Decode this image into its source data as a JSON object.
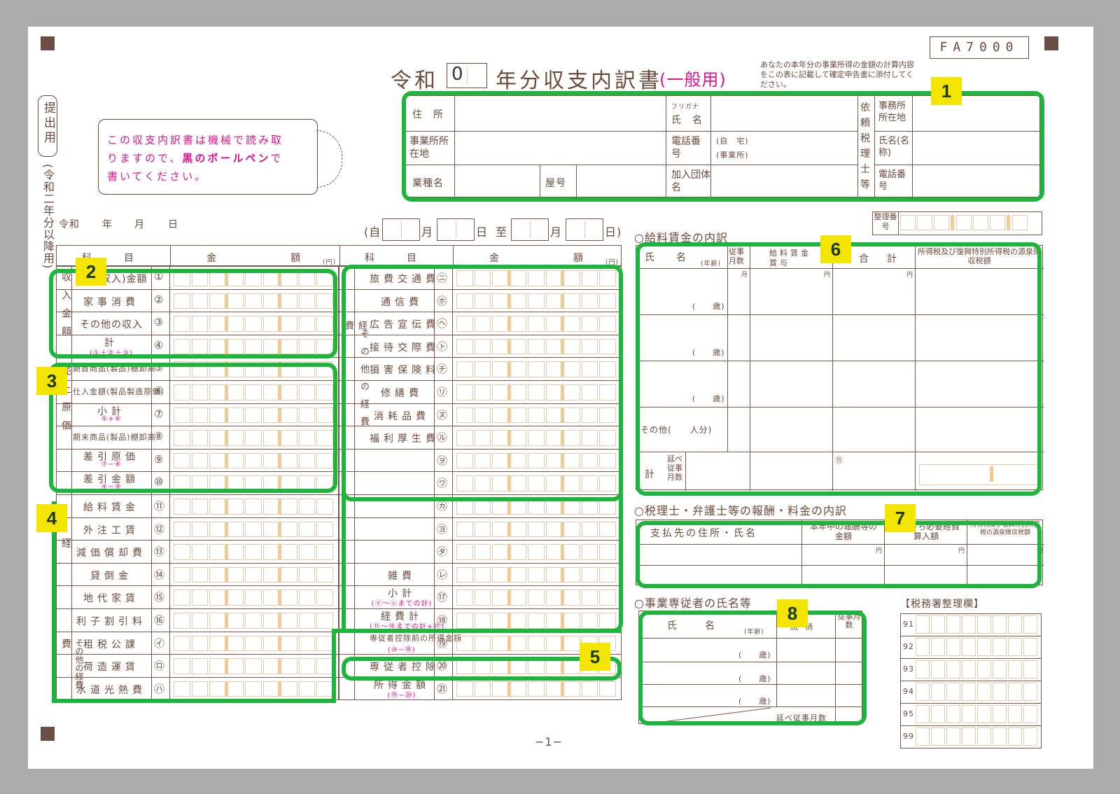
{
  "form_code": "FA7000",
  "title": {
    "prefix": "令和",
    "year_value": "0",
    "main": "年分収支内訳書",
    "kind": "(一般用)",
    "note": "あなたの本年分の事業所得の金額の計算内容をこの表に記載して確定申告書に添付してください。"
  },
  "side": {
    "submit": "提出用",
    "version": "(令和二年分以降用)"
  },
  "notice": {
    "line1": "この収支内訳書は機械で読み取",
    "line2a": "りますので、",
    "line2b": "黒のボールペン",
    "line2c": "で",
    "line3": "書いてください。"
  },
  "info": {
    "address": "住　所",
    "furigana": "フリガナ",
    "name": "氏　名",
    "biz_address": "事業所所在地",
    "phone": "電話番号",
    "home": "(自　宅)",
    "office": "(事業所)",
    "industry": "業種名",
    "trade_name": "屋号",
    "association": "加入団体名",
    "tax_acct": "依頼税理士等",
    "office_loc": "事務所所在地",
    "acct_name": "氏名(名称)",
    "acct_phone": "電話番号",
    "ref_no": "整理番号"
  },
  "date": {
    "reiwa": "令和",
    "year": "年",
    "month": "月",
    "day": "日",
    "period_from": "(自",
    "period_m1": "月",
    "period_d1": "日",
    "period_to": "至",
    "period_m2": "月",
    "period_d2": "日)"
  },
  "table_head": {
    "subject": "科　　　目",
    "amount": "金　　　　　額",
    "yen": "(円)"
  },
  "income_group": "収入金額",
  "cost_group": "売上原価",
  "expense_group": "経費",
  "other_group": "その他の経費",
  "left_rows": [
    {
      "label": "売上(収入)金額",
      "num": "①"
    },
    {
      "label": "家事消費",
      "num": "②"
    },
    {
      "label": "その他の収入",
      "num": "③"
    },
    {
      "label": "計",
      "sub": "(①＋②＋③)",
      "num": "④"
    },
    {
      "label": "期首商品(製品)棚卸高",
      "num": "⑤"
    },
    {
      "label": "仕入金額(製品製造原価)",
      "num": "⑥"
    },
    {
      "label": "小計",
      "sub": "⑤+⑥",
      "num": "⑦"
    },
    {
      "label": "期末商品(製品)棚卸高",
      "num": "⑧"
    },
    {
      "label": "差引原価",
      "sub": "⑦−⑧",
      "num": "⑨"
    },
    {
      "label": "差引金額",
      "sub": "④−⑨",
      "num": "⑩"
    },
    {
      "label": "給料賃金",
      "num": "⑪"
    },
    {
      "label": "外注工賃",
      "num": "⑫"
    },
    {
      "label": "減価償却費",
      "num": "⑬"
    },
    {
      "label": "貸倒金",
      "num": "⑭"
    },
    {
      "label": "地代家賃",
      "num": "⑮"
    },
    {
      "label": "利子割引料",
      "num": "⑯"
    },
    {
      "label": "租税公課",
      "num": "㋑"
    },
    {
      "label": "荷造運賃",
      "num": "㋺"
    },
    {
      "label": "水道光熱費",
      "num": "㋩"
    }
  ],
  "right_rows": [
    {
      "label": "旅費交通費",
      "num": "㋥"
    },
    {
      "label": "通信費",
      "num": "㋭"
    },
    {
      "label": "広告宣伝費",
      "num": "㋬"
    },
    {
      "label": "接待交際費",
      "num": "㋣"
    },
    {
      "label": "損害保険料",
      "num": "㋠"
    },
    {
      "label": "修繕費",
      "num": "㋷"
    },
    {
      "label": "消耗品費",
      "num": "㋦"
    },
    {
      "label": "福利厚生費",
      "num": "㋸"
    },
    {
      "label": "",
      "num": "㋾"
    },
    {
      "label": "",
      "num": "㋻"
    },
    {
      "label": "",
      "num": "㋕"
    },
    {
      "label": "",
      "num": "㋵"
    },
    {
      "label": "",
      "num": "㋟"
    },
    {
      "label": "雑費",
      "num": "㋹"
    },
    {
      "label": "小計",
      "sub": "(㋑〜㋹までの計)",
      "num": "⑰"
    },
    {
      "label": "経費計",
      "sub": "(⑪〜⑯までの計+⑰)",
      "num": "⑱"
    },
    {
      "label": "専従者控除前の所得金額",
      "sub": "(⑩−⑱)",
      "num": "⑲"
    },
    {
      "label": "専従者控除",
      "num": "⑳"
    },
    {
      "label": "所得金額",
      "sub": "(⑲−⑳)",
      "num": "㉑"
    }
  ],
  "salary": {
    "title": "○給料賃金の内訳",
    "col_name": "氏　　名",
    "col_age": "(年齢)",
    "col_months": "従事月数",
    "col_pay": "給料賃金",
    "col_bonus": "賞与",
    "col_total": "合　計",
    "col_tax": "所得税及び復興特別所得税の源泉徴収税額",
    "age": "(　　歳)",
    "others": "その他(　　人分)",
    "total": "計",
    "total_months": "延べ従事月数",
    "yen": "円",
    "month_unit": "月",
    "num11": "⑪"
  },
  "fees": {
    "title": "○税理士・弁護士等の報酬・料金の内訳",
    "col_payee": "支払先の住所・氏名",
    "col_amount": "本年中の報酬等の金額",
    "col_expense": "左のうち必要経費算入額",
    "col_tax": "所得税及び復興特別所得税の源泉徴収税額",
    "yen": "円"
  },
  "family": {
    "title": "○事業専従者の氏名等",
    "col_name": "氏　　名",
    "col_age": "(年齢)",
    "col_relation": "続柄",
    "col_months": "従事月数",
    "age": "(　　歳)",
    "total_months": "延べ従事月数"
  },
  "office_use": {
    "title": "【税務署整理欄】",
    "rows": [
      "91",
      "92",
      "93",
      "94",
      "95",
      "99"
    ]
  },
  "page_no": "−1−",
  "callouts": [
    "1",
    "2",
    "3",
    "4",
    "5",
    "6",
    "7",
    "8"
  ]
}
